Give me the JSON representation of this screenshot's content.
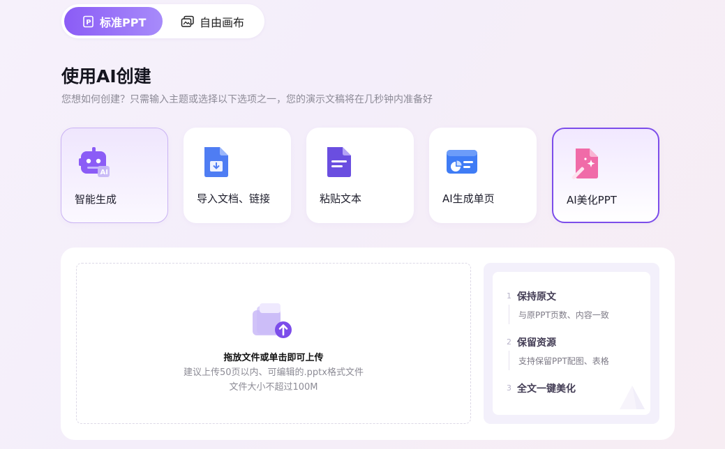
{
  "mode_switch": {
    "tabs": [
      {
        "label": "标准PPT",
        "active": true
      },
      {
        "label": "自由画布",
        "active": false
      }
    ]
  },
  "header": {
    "title": "使用AI创建",
    "subtitle": "您想如何创建？只需输入主题或选择以下选项之一，您的演示文稿将在几秒钟内准备好"
  },
  "options": [
    {
      "label": "智能生成",
      "icon": "ai-robot-icon"
    },
    {
      "label": "导入文档、链接",
      "icon": "import-document-icon"
    },
    {
      "label": "粘贴文本",
      "icon": "paste-text-icon"
    },
    {
      "label": "AI生成单页",
      "icon": "single-page-icon"
    },
    {
      "label": "AI美化PPT",
      "icon": "magic-wand-icon",
      "selected": true
    }
  ],
  "upload": {
    "title": "拖放文件或单击即可上传",
    "hint_line1": "建议上传50页以内、可编辑的.pptx格式文件",
    "hint_line2": "文件大小不超过100M"
  },
  "steps": [
    {
      "num": "1",
      "title": "保持原文",
      "desc": "与原PPT页数、内容一致"
    },
    {
      "num": "2",
      "title": "保留资源",
      "desc": "支持保留PPT配图、表格"
    },
    {
      "num": "3",
      "title": "全文一键美化",
      "desc": ""
    }
  ],
  "colors": {
    "accent": "#8b5cf6",
    "selected_border": "#7c4dea"
  }
}
